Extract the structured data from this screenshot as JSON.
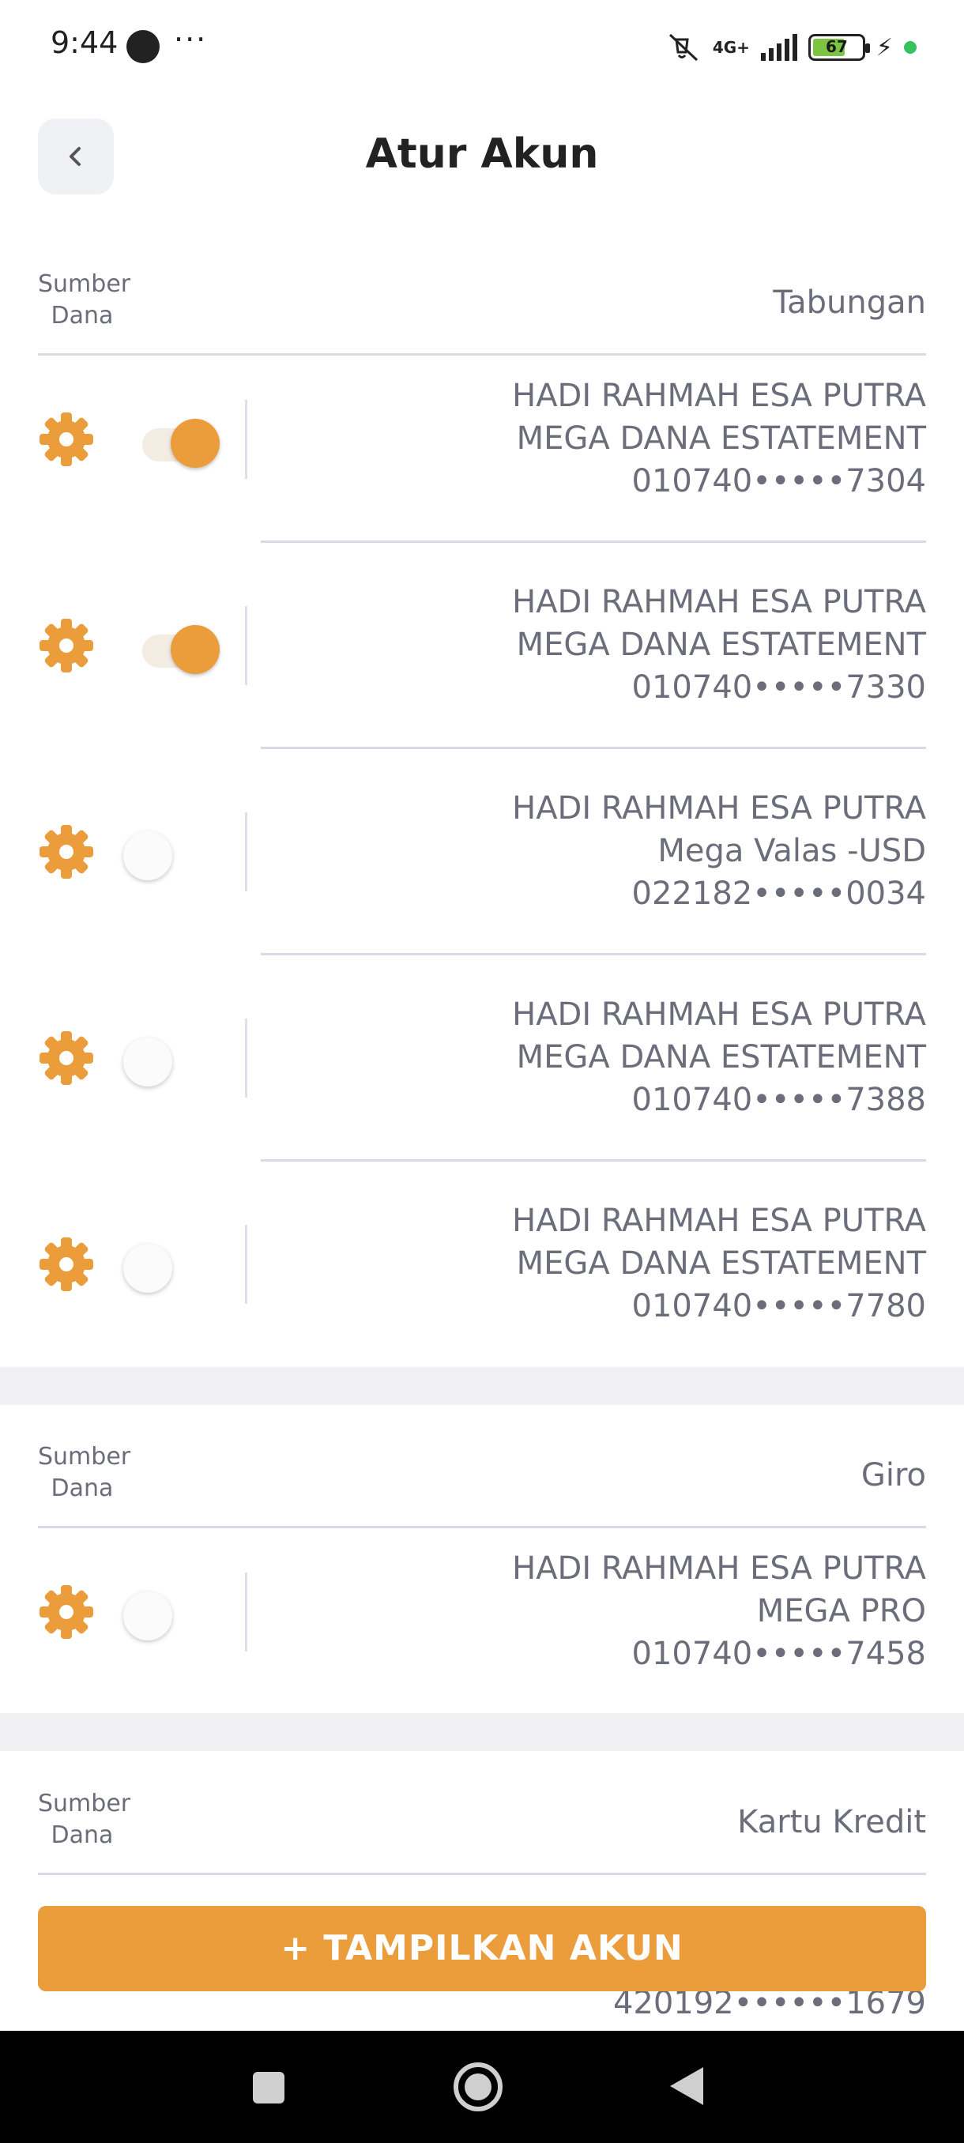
{
  "status_bar": {
    "time": "9:44",
    "more": "···",
    "network": "4G+",
    "battery": "67"
  },
  "header": {
    "title": "Atur Akun"
  },
  "sections": [
    {
      "label": "Sumber Dana",
      "type": "Tabungan",
      "accounts": [
        {
          "name": "HADI RAHMAH ESA PUTRA",
          "product": "MEGA DANA ESTATEMENT",
          "number": "010740•••••7304",
          "enabled": true
        },
        {
          "name": "HADI RAHMAH ESA PUTRA",
          "product": "MEGA DANA ESTATEMENT",
          "number": "010740•••••7330",
          "enabled": true
        },
        {
          "name": "HADI RAHMAH ESA PUTRA",
          "product": "Mega Valas -USD",
          "number": "022182•••••0034",
          "enabled": false
        },
        {
          "name": "HADI RAHMAH ESA PUTRA",
          "product": "MEGA DANA ESTATEMENT",
          "number": "010740•••••7388",
          "enabled": false
        },
        {
          "name": "HADI RAHMAH ESA PUTRA",
          "product": "MEGA DANA ESTATEMENT",
          "number": "010740•••••7780",
          "enabled": false
        }
      ]
    },
    {
      "label": "Sumber Dana",
      "type": "Giro",
      "accounts": [
        {
          "name": "HADI RAHMAH ESA PUTRA",
          "product": "MEGA PRO",
          "number": "010740•••••7458",
          "enabled": false
        }
      ]
    },
    {
      "label": "Sumber Dana",
      "type": "Kartu Kredit",
      "accounts": [
        {
          "number": "420192••••••1679"
        }
      ]
    }
  ],
  "cta": {
    "label": "+ TAMPILKAN AKUN"
  },
  "colors": {
    "accent": "#eb9c3b",
    "text": "#6b6e7a",
    "title": "#222222"
  }
}
